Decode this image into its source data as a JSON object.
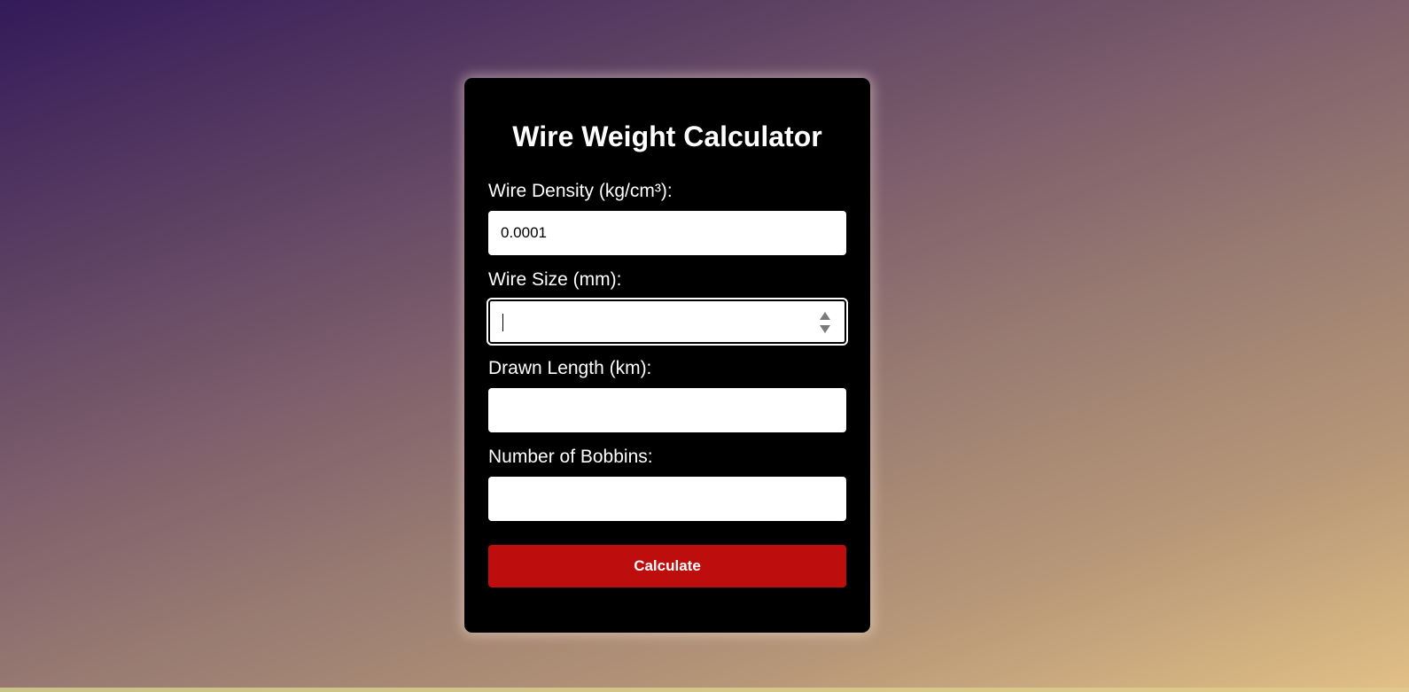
{
  "app": {
    "title": "Wire Weight Calculator"
  },
  "form": {
    "density": {
      "label": "Wire Density (kg/cm³):",
      "value": "0.0001"
    },
    "size": {
      "label": "Wire Size (mm):",
      "value": ""
    },
    "length": {
      "label": "Drawn Length (km):",
      "value": ""
    },
    "bobbins": {
      "label": "Number of Bobbins:",
      "value": ""
    },
    "submit_label": "Calculate"
  },
  "colors": {
    "card_background": "#000000",
    "button": "#bd0d0d",
    "button_text": "#ffffff",
    "label_text": "#ffffff"
  },
  "icons": {
    "size_spinner": "spinner-arrows-icon"
  }
}
